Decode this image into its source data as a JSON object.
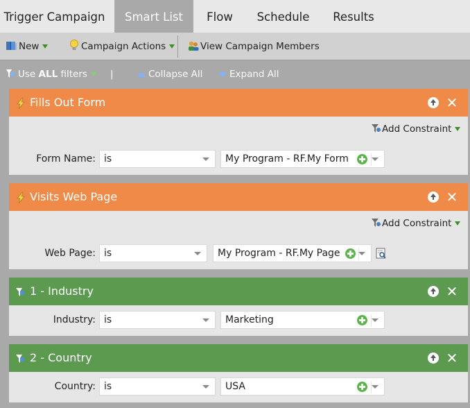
{
  "tabs": [
    {
      "label": "Trigger Campaign",
      "active": false
    },
    {
      "label": "Smart List",
      "active": true
    },
    {
      "label": "Flow",
      "active": false
    },
    {
      "label": "Schedule",
      "active": false
    },
    {
      "label": "Results",
      "active": false
    }
  ],
  "toolbar": {
    "new_label": "New",
    "campaign_actions_label": "Campaign Actions",
    "view_members_label": "View Campaign Members"
  },
  "filter_options": {
    "use_prefix": "Use",
    "use_bold": "ALL",
    "use_suffix": "filters",
    "separator": "|",
    "collapse_label": "Collapse All",
    "expand_label": "Expand All"
  },
  "filters": [
    {
      "title": "Fills Out Form",
      "kind": "trigger",
      "color": "#ef8a48",
      "add_constraint": "Add Constraint",
      "field_label": "Form Name:",
      "operator": "is",
      "value": "My Program - RF.My Form"
    },
    {
      "title": "Visits Web Page",
      "kind": "trigger",
      "color": "#ef8a48",
      "add_constraint": "Add Constraint",
      "field_label": "Web Page:",
      "operator": "is",
      "value": "My Program - RF.My Page"
    },
    {
      "title": "1 - Industry",
      "kind": "filter",
      "color": "#5b9a4f",
      "field_label": "Industry:",
      "operator": "is",
      "value": "Marketing"
    },
    {
      "title": "2 - Country",
      "kind": "filter",
      "color": "#5b9a4f",
      "field_label": "Country:",
      "operator": "is",
      "value": "USA"
    }
  ],
  "icons": {
    "header_close": "✕"
  }
}
